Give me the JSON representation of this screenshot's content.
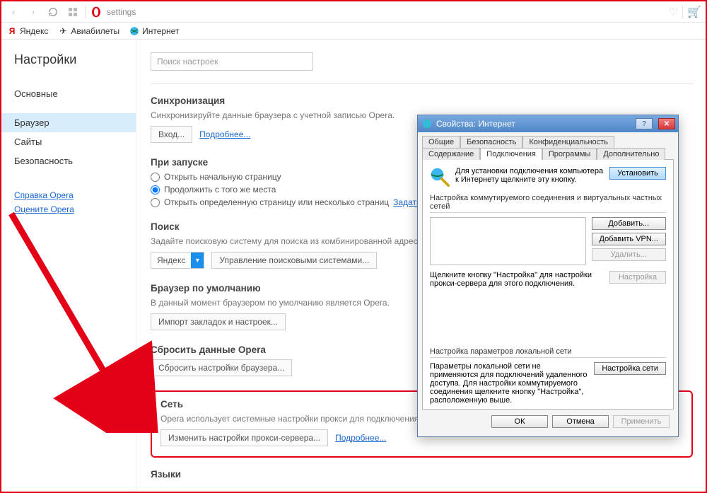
{
  "chrome": {
    "address": "settings",
    "bookmarks": [
      {
        "label": "Яндекс"
      },
      {
        "label": "Авиабилеты"
      },
      {
        "label": "Интернет"
      }
    ]
  },
  "sidebar": {
    "title": "Настройки",
    "items": [
      {
        "label": "Основные"
      },
      {
        "label": "Браузер",
        "active": true
      },
      {
        "label": "Сайты"
      },
      {
        "label": "Безопасность"
      }
    ],
    "links": [
      "Справка Opera",
      "Оцените Opera"
    ]
  },
  "main": {
    "search_placeholder": "Поиск настроек",
    "sync": {
      "title": "Синхронизация",
      "desc": "Синхронизируйте данные браузера с учетной записью Opera.",
      "login": "Вход...",
      "more": "Подробнее..."
    },
    "startup": {
      "title": "При запуске",
      "opt1": "Открыть начальную страницу",
      "opt2": "Продолжить с того же места",
      "opt3": "Открыть определенную страницу или несколько страниц",
      "set_pages": "Задать страницы"
    },
    "search": {
      "title": "Поиск",
      "desc": "Задайте поисковую систему для поиска из комбинированной адресной строки.",
      "engine": "Яндекс",
      "manage": "Управление поисковыми системами..."
    },
    "default_browser": {
      "title": "Браузер по умолчанию",
      "desc": "В данный момент браузером по умолчанию является Opera.",
      "import": "Импорт закладок и настроек..."
    },
    "reset": {
      "title": "Сбросить данные Opera",
      "btn": "Сбросить настройки браузера..."
    },
    "network": {
      "title": "Сеть",
      "desc": "Opera использует системные настройки прокси для подключения к сети.",
      "btn": "Изменить настройки прокси-сервера...",
      "more": "Подробнее..."
    },
    "languages_title": "Языки"
  },
  "dialog": {
    "title": "Свойства: Интернет",
    "tabs_row1": [
      "Общие",
      "Безопасность",
      "Конфиденциальность"
    ],
    "tabs_row2": [
      "Содержание",
      "Подключения",
      "Программы",
      "Дополнительно"
    ],
    "active_tab": "Подключения",
    "setup_text": "Для установки подключения компьютера к Интернету щелкните эту кнопку.",
    "setup_btn": "Установить",
    "dialup_label": "Настройка коммутируемого соединения и виртуальных частных сетей",
    "add_btn": "Добавить...",
    "add_vpn_btn": "Добавить VPN...",
    "remove_btn": "Удалить...",
    "proxy_hint": "Щелкните кнопку \"Настройка\" для настройки прокси-сервера для этого подключения.",
    "settings_btn": "Настройка",
    "lan_label": "Настройка параметров локальной сети",
    "lan_text": "Параметры локальной сети не применяются для подключений удаленного доступа. Для настройки коммутируемого соединения щелкните кнопку \"Настройка\", расположенную выше.",
    "lan_btn": "Настройка сети",
    "ok": "ОК",
    "cancel": "Отмена",
    "apply": "Применить"
  }
}
